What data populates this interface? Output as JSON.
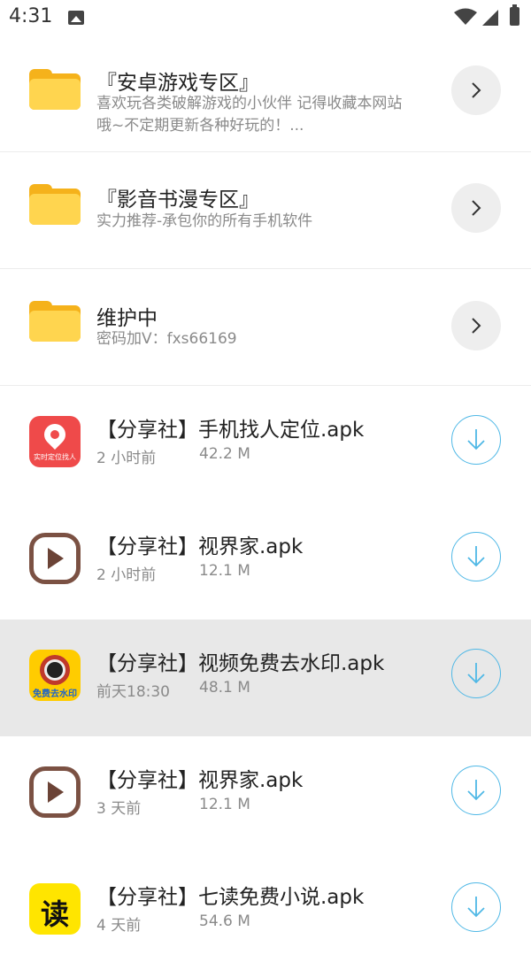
{
  "status_bar": {
    "time": "4:31"
  },
  "folders": [
    {
      "title": "『安卓游戏专区』",
      "subtitle_line1": "喜欢玩各类破解游戏的小伙伴 记得收藏本网站",
      "subtitle_line2": "哦~不定期更新各种好玩的！..."
    },
    {
      "title": "『影音书漫专区』",
      "subtitle_line1": "实力推荐-承包你的所有手机软件"
    },
    {
      "title": "维护中",
      "subtitle_line1": "密码加V：fxs66169"
    }
  ],
  "files": [
    {
      "title": "【分享社】手机找人定位.apk",
      "time": "2 小时前",
      "size": "42.2 M",
      "icon": "location-pin-icon",
      "icon_caption": "实时定位找人"
    },
    {
      "title": "【分享社】视界家.apk",
      "time": "2 小时前",
      "size": "12.1 M",
      "icon": "play-icon"
    },
    {
      "title": "【分享社】视频免费去水印.apk",
      "time": "前天18:30",
      "size": "48.1 M",
      "icon": "camera-lens-icon",
      "icon_caption": "免费去水印",
      "selected": true
    },
    {
      "title": "【分享社】视界家.apk",
      "time": "3 天前",
      "size": "12.1 M",
      "icon": "play-icon"
    },
    {
      "title": "【分享社】七读免费小说.apk",
      "time": "4 天前",
      "size": "54.6 M",
      "icon": "book-read-icon",
      "icon_glyph": "读"
    }
  ],
  "colors": {
    "folder_front": "#ffd54f",
    "folder_back": "#f5b21b",
    "download_accent": "#4fb8e6",
    "selected_row": "#e8e8e8"
  }
}
